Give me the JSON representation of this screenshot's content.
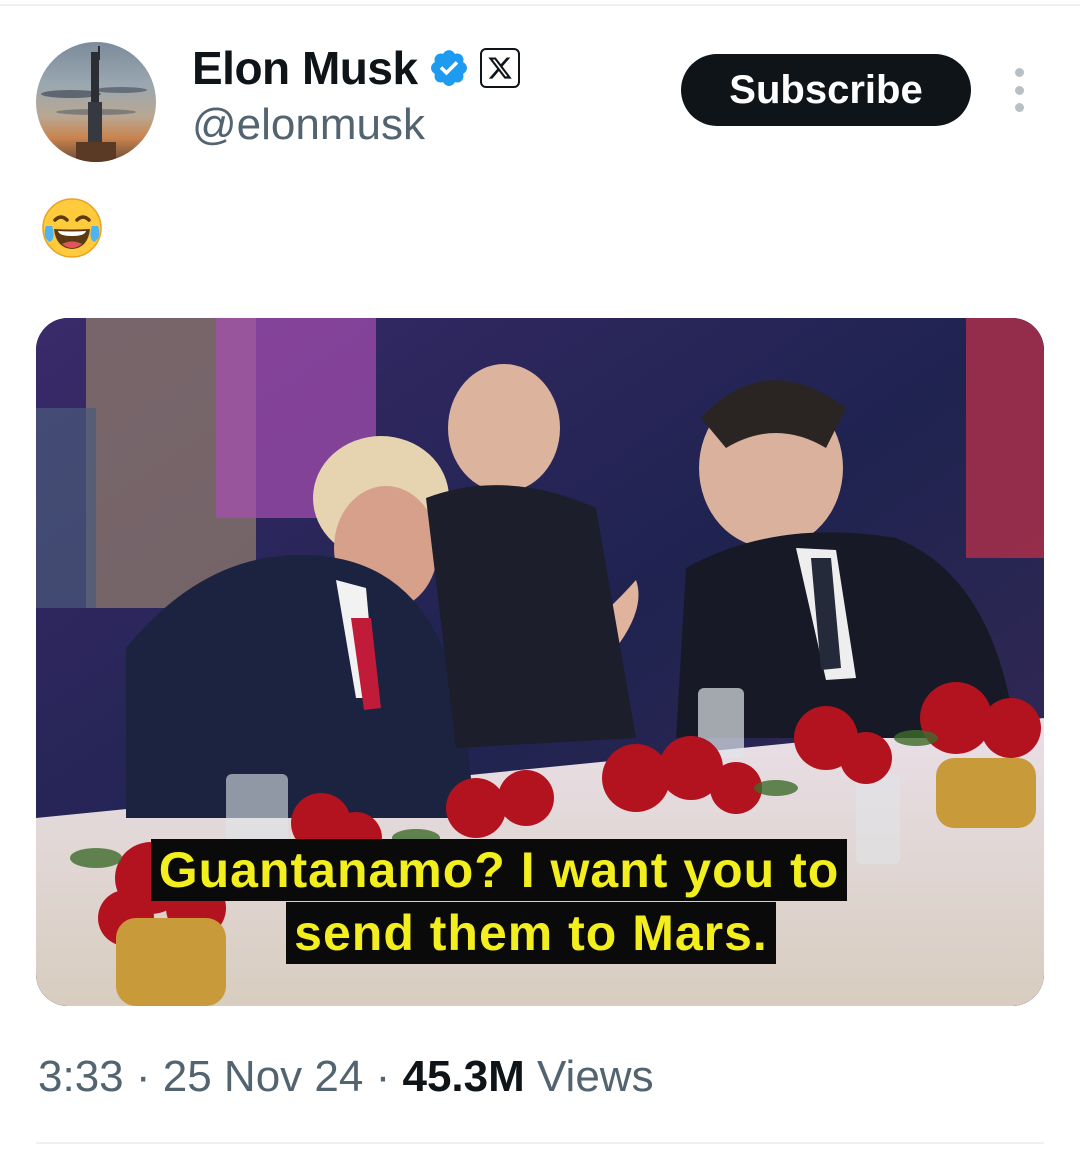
{
  "author": {
    "display_name": "Elon Musk",
    "handle": "@elonmusk",
    "verified_icon": "verified-badge-icon",
    "affiliation_icon": "x-logo-icon",
    "avatar": "starship-launch-avatar"
  },
  "actions": {
    "subscribe_label": "Subscribe",
    "more_icon": "more-vertical-icon"
  },
  "tweet": {
    "text_emoji": "😂",
    "media": {
      "type": "image",
      "caption_line1": "Guantanamo? I want you to",
      "caption_line2": "send them to Mars."
    }
  },
  "meta": {
    "time": "3:33",
    "separator": "·",
    "date": "25 Nov 24",
    "views_count": "45.3M",
    "views_label": "Views"
  },
  "colors": {
    "text_primary": "#0f1419",
    "text_secondary": "#536471",
    "verified_blue": "#1d9bf0",
    "caption_yellow": "#f3ee1e"
  }
}
